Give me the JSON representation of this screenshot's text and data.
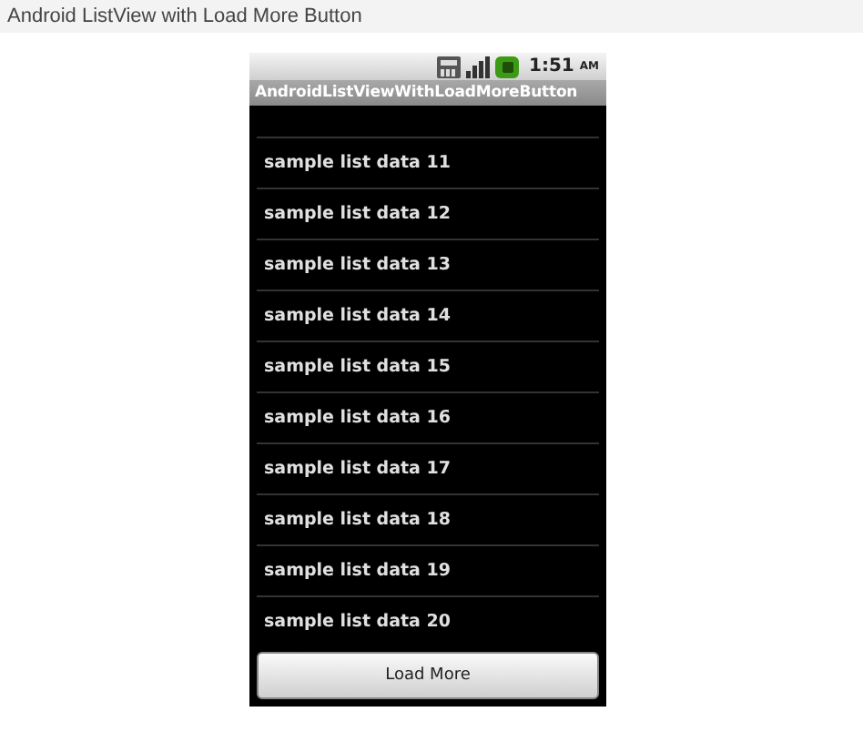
{
  "page": {
    "title": "Android ListView with Load More Button"
  },
  "status_bar": {
    "time": "1:51",
    "meridiem": "AM"
  },
  "app": {
    "title": "AndroidListViewWithLoadMoreButton"
  },
  "list": {
    "items": [
      {
        "label": "sample list data 11"
      },
      {
        "label": "sample list data 12"
      },
      {
        "label": "sample list data 13"
      },
      {
        "label": "sample list data 14"
      },
      {
        "label": "sample list data 15"
      },
      {
        "label": "sample list data 16"
      },
      {
        "label": "sample list data 17"
      },
      {
        "label": "sample list data 18"
      },
      {
        "label": "sample list data 19"
      },
      {
        "label": "sample list data 20"
      }
    ]
  },
  "button": {
    "label": "Load More"
  }
}
